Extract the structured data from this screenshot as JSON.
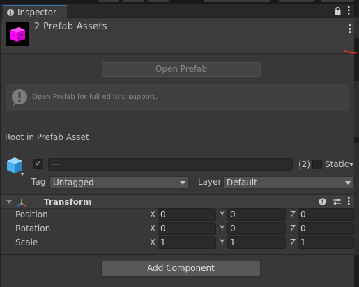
{
  "window": {
    "tab_label": "Inspector",
    "tab_icon": "info-icon",
    "tab_actions": [
      "lock-icon",
      "kebab-menu-icon"
    ]
  },
  "header": {
    "title": "2 Prefab Assets",
    "thumbnail_icon": "prefab-cube-icon",
    "thumbnail_color": "#ff00ff",
    "menu_icon": "kebab-menu-icon",
    "annotation_color": "#e03030"
  },
  "prefab": {
    "open_button": "Open Prefab",
    "help_text": "Open Prefab for full editing support."
  },
  "section": {
    "root_label": "Root in Prefab Asset"
  },
  "gameobject": {
    "active": true,
    "name_value": "—",
    "count": "(2)",
    "static_label": "Static",
    "tag_label": "Tag",
    "tag_value": "Untagged",
    "layer_label": "Layer",
    "layer_value": "Default"
  },
  "transform": {
    "title": "Transform",
    "actions": [
      "help-icon",
      "preset-icon",
      "kebab-menu-icon"
    ],
    "rows": [
      {
        "label": "Position",
        "x": "0",
        "y": "0",
        "z": "0"
      },
      {
        "label": "Rotation",
        "x": "0",
        "y": "0",
        "z": "0"
      },
      {
        "label": "Scale",
        "x": "1",
        "y": "1",
        "z": "1"
      }
    ],
    "axis_labels": [
      "X",
      "Y",
      "Z"
    ]
  },
  "footer": {
    "add_component": "Add Component"
  },
  "colors": {
    "accent": "#3a72b0",
    "panel": "#383838",
    "field": "#2a2a2a"
  }
}
